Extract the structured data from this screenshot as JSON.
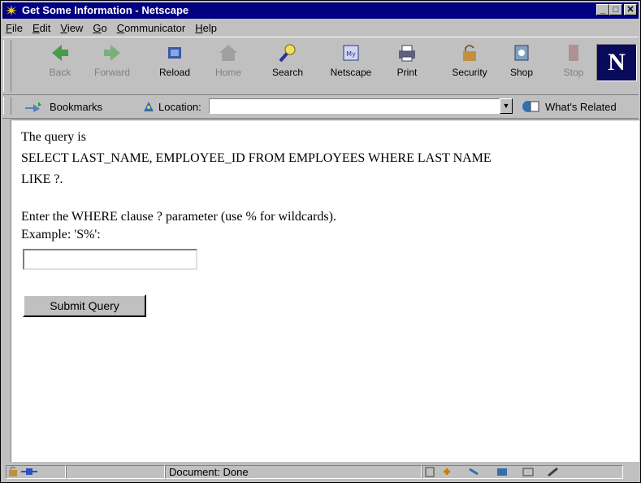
{
  "window": {
    "title": "Get Some Information - Netscape"
  },
  "menu": [
    "File",
    "Edit",
    "View",
    "Go",
    "Communicator",
    "Help"
  ],
  "toolbar": {
    "back": "Back",
    "forward": "Forward",
    "reload": "Reload",
    "home": "Home",
    "search": "Search",
    "netscape": "Netscape",
    "print": "Print",
    "security": "Security",
    "shop": "Shop",
    "stop": "Stop"
  },
  "locbar": {
    "bookmarks": "Bookmarks",
    "location_label": "Location:",
    "location_value": "",
    "related": "What's Related"
  },
  "page": {
    "line1": "The query is",
    "line2": "SELECT LAST_NAME, EMPLOYEE_ID FROM EMPLOYEES WHERE LAST NAME",
    "line3": "LIKE ?.",
    "line4": "Enter the WHERE clause ? parameter (use % for wildcards).",
    "line5": "Example: 'S%':",
    "input_value": "",
    "submit_label": "Submit Query"
  },
  "status": {
    "text": "Document: Done"
  },
  "colors": {
    "titlebar": "#000080",
    "chrome": "#c0c0c0",
    "page_bg": "#ffffff"
  }
}
